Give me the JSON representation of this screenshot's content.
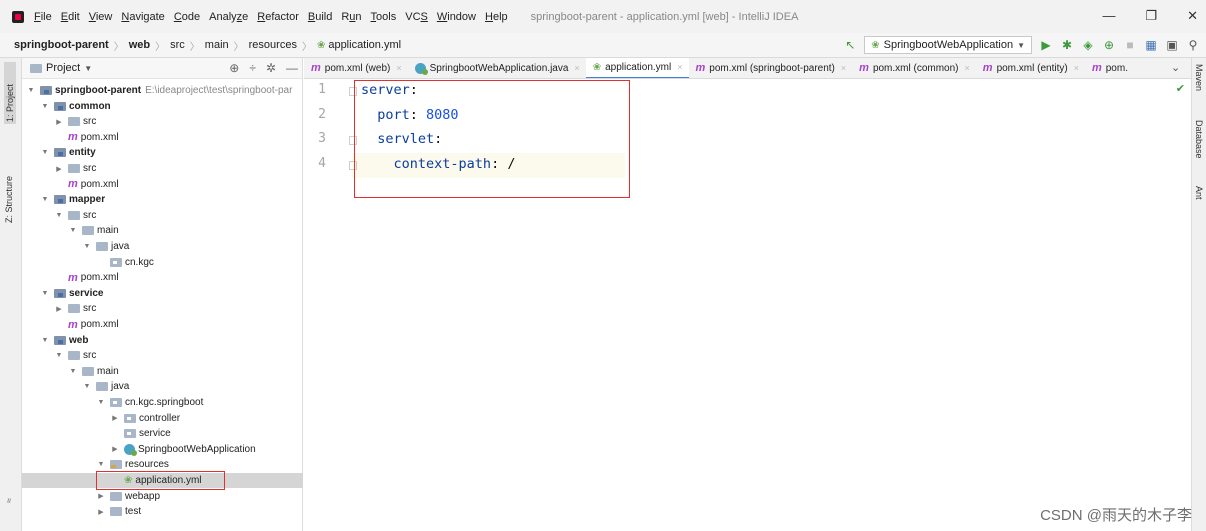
{
  "menu": {
    "items": [
      {
        "pre": "",
        "u": "F",
        "post": "ile"
      },
      {
        "pre": "",
        "u": "E",
        "post": "dit"
      },
      {
        "pre": "",
        "u": "V",
        "post": "iew"
      },
      {
        "pre": "",
        "u": "N",
        "post": "avigate"
      },
      {
        "pre": "",
        "u": "C",
        "post": "ode"
      },
      {
        "pre": "Analy",
        "u": "z",
        "post": "e"
      },
      {
        "pre": "",
        "u": "R",
        "post": "efactor"
      },
      {
        "pre": "",
        "u": "B",
        "post": "uild"
      },
      {
        "pre": "R",
        "u": "u",
        "post": "n"
      },
      {
        "pre": "",
        "u": "T",
        "post": "ools"
      },
      {
        "pre": "VC",
        "u": "S",
        "post": ""
      },
      {
        "pre": "",
        "u": "W",
        "post": "indow"
      },
      {
        "pre": "",
        "u": "H",
        "post": "elp"
      }
    ],
    "window_title": "springboot-parent - application.yml [web] - IntelliJ IDEA"
  },
  "window_controls": {
    "minimize": "—",
    "restore": "❐",
    "close": "✕"
  },
  "breadcrumb": [
    "springboot-parent",
    "web",
    "src",
    "main",
    "resources",
    "application.yml"
  ],
  "run_config": {
    "label": "SpringbootWebApplication"
  },
  "left_tabs": {
    "project": "1: Project",
    "structure": "Z: Structure",
    "favorites": "≈"
  },
  "project_panel": {
    "title": "Project"
  },
  "tree": [
    {
      "label": "springboot-parent",
      "path": "E:\\ideaproject\\test\\springboot-par",
      "bold": true,
      "icon": "module",
      "arrow": "open"
    },
    {
      "label": "common",
      "bold": true,
      "icon": "module",
      "arrow": "open"
    },
    {
      "label": "src",
      "icon": "folder",
      "arrow": "closed"
    },
    {
      "label": "pom.xml",
      "icon": "maven"
    },
    {
      "label": "entity",
      "bold": true,
      "icon": "module",
      "arrow": "open"
    },
    {
      "label": "src",
      "icon": "folder",
      "arrow": "closed"
    },
    {
      "label": "pom.xml",
      "icon": "maven"
    },
    {
      "label": "mapper",
      "bold": true,
      "icon": "module",
      "arrow": "open"
    },
    {
      "label": "src",
      "icon": "folder",
      "arrow": "open"
    },
    {
      "label": "main",
      "icon": "folder",
      "arrow": "open"
    },
    {
      "label": "java",
      "icon": "folder",
      "arrow": "open"
    },
    {
      "label": "cn.kgc",
      "icon": "package"
    },
    {
      "label": "pom.xml",
      "icon": "maven"
    },
    {
      "label": "service",
      "bold": true,
      "icon": "module",
      "arrow": "open"
    },
    {
      "label": "src",
      "icon": "folder",
      "arrow": "closed"
    },
    {
      "label": "pom.xml",
      "icon": "maven"
    },
    {
      "label": "web",
      "bold": true,
      "icon": "module",
      "arrow": "open"
    },
    {
      "label": "src",
      "icon": "folder",
      "arrow": "open"
    },
    {
      "label": "main",
      "icon": "folder",
      "arrow": "open"
    },
    {
      "label": "java",
      "icon": "folder",
      "arrow": "open"
    },
    {
      "label": "cn.kgc.springboot",
      "icon": "package",
      "arrow": "open"
    },
    {
      "label": "controller",
      "icon": "package",
      "arrow": "closed"
    },
    {
      "label": "service",
      "icon": "package"
    },
    {
      "label": "SpringbootWebApplication",
      "icon": "spring",
      "arrow": "closed"
    },
    {
      "label": "resources",
      "icon": "resources",
      "arrow": "open"
    },
    {
      "label": "application.yml",
      "icon": "yml",
      "selected": true
    },
    {
      "label": "webapp",
      "icon": "folder",
      "arrow": "closed"
    },
    {
      "label": "test",
      "icon": "folder",
      "arrow": "closed"
    }
  ],
  "editor_tabs": [
    {
      "label": "pom.xml (web)",
      "icon": "maven"
    },
    {
      "label": "SpringbootWebApplication.java",
      "icon": "spring"
    },
    {
      "label": "application.yml",
      "icon": "yml",
      "active": true
    },
    {
      "label": "pom.xml (springboot-parent)",
      "icon": "maven"
    },
    {
      "label": "pom.xml (common)",
      "icon": "maven"
    },
    {
      "label": "pom.xml (entity)",
      "icon": "maven"
    },
    {
      "label": "pom.",
      "icon": "maven"
    }
  ],
  "code": {
    "line_numbers": [
      "1",
      "2",
      "3",
      "4"
    ],
    "lines": [
      {
        "indent": "",
        "key": "server",
        "sep": ":",
        "value": ""
      },
      {
        "indent": "  ",
        "key": "port",
        "sep": ": ",
        "value": "8080"
      },
      {
        "indent": "  ",
        "key": "servlet",
        "sep": ":",
        "value": ""
      },
      {
        "indent": "    ",
        "key": "context-path",
        "sep": ": ",
        "value": "/"
      }
    ]
  },
  "right_tabs": {
    "maven": "Maven",
    "database": "Database",
    "ant": "Ant"
  },
  "watermark": "CSDN @雨天的木子李",
  "colors": {
    "highlight_box": "#e0302f",
    "yaml_key": "#0a3e9e",
    "yaml_value": "#1750eb"
  }
}
